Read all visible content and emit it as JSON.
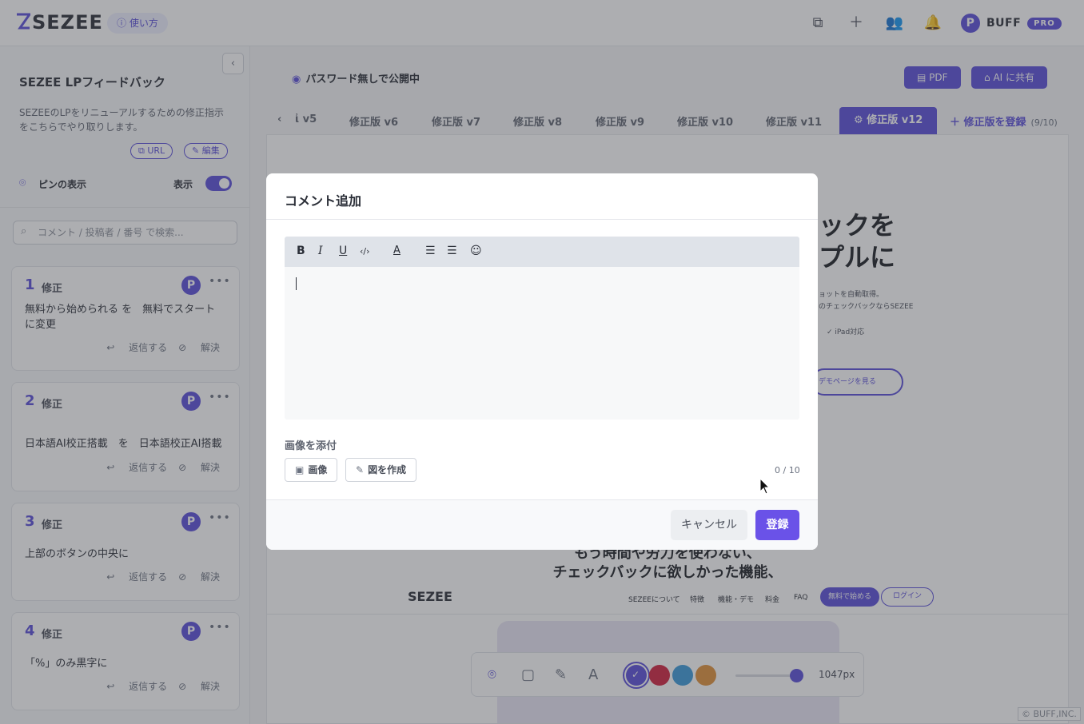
{
  "header": {
    "logo": "SEZEE",
    "howto_label": "使い方",
    "user_initial": "P",
    "user_name": "BUFF",
    "plan_badge": "PRO"
  },
  "sidebar": {
    "project_title": "SEZEE LPフィードバック",
    "project_desc": "SEZEEのLPをリニューアルするための修正指示をこちらでやり取りします。",
    "url_chip": "URL",
    "edit_chip": "編集",
    "pin_label": "ピンの表示",
    "pin_show_label": "表示",
    "search_placeholder": "コメント / 投稿者 / 番号 で検索...",
    "comments": [
      {
        "num": "1",
        "type": "修正",
        "text": "無料から始められる を　無料でスタート　に変更",
        "reply": "返信する",
        "resolve": "解決"
      },
      {
        "num": "2",
        "type": "修正",
        "text": "日本語AI校正搭載　を　日本語校正AI搭載",
        "reply": "返信する",
        "resolve": "解決"
      },
      {
        "num": "3",
        "type": "修正",
        "text": "上部のボタンの中央に",
        "reply": "返信する",
        "resolve": "解決"
      },
      {
        "num": "4",
        "type": "修正",
        "text": "「%」のみ黒字に",
        "reply": "返信する",
        "resolve": "解決"
      }
    ]
  },
  "main": {
    "public_status": "パスワード無しで公開中",
    "pdf_button": "PDF",
    "ai_share_button": "AI に共有",
    "tabs": [
      "v5",
      "修正版 v6",
      "修正版 v7",
      "修正版 v8",
      "修正版 v9",
      "修正版 v10",
      "修正版 v11",
      "修正版 v12"
    ],
    "add_version": "修正版を登録",
    "version_count": "(9/10)",
    "preview": {
      "headline_1": "ックを",
      "headline_2": "プルに",
      "sub_1": "ョットを自動取得。",
      "sub_2": "のチェックバックならSEZEE",
      "ipad": "iPad対応",
      "demo_button": "デモページを見る",
      "mid_1": "もう時間や労力を使わない、",
      "mid_2": "チェックバックに欲しかった機能、",
      "nav_logo": "SEZEE",
      "nav_links": [
        "SEZEEについて",
        "特徴",
        "機能・デモ",
        "料金",
        "FAQ"
      ],
      "nav_start": "無料で始める",
      "nav_login": "ログイン"
    },
    "brush_size": "1047px",
    "colors": [
      "#5b4fd9",
      "#d0213f",
      "#3b9ad9",
      "#e0913a"
    ]
  },
  "modal": {
    "title": "コメント追加",
    "attach_label": "画像を添付",
    "image_button": "画像",
    "draw_button": "図を作成",
    "attach_count": "0 / 10",
    "cancel_button": "キャンセル",
    "submit_button": "登録"
  },
  "copyright": "© BUFF,INC."
}
